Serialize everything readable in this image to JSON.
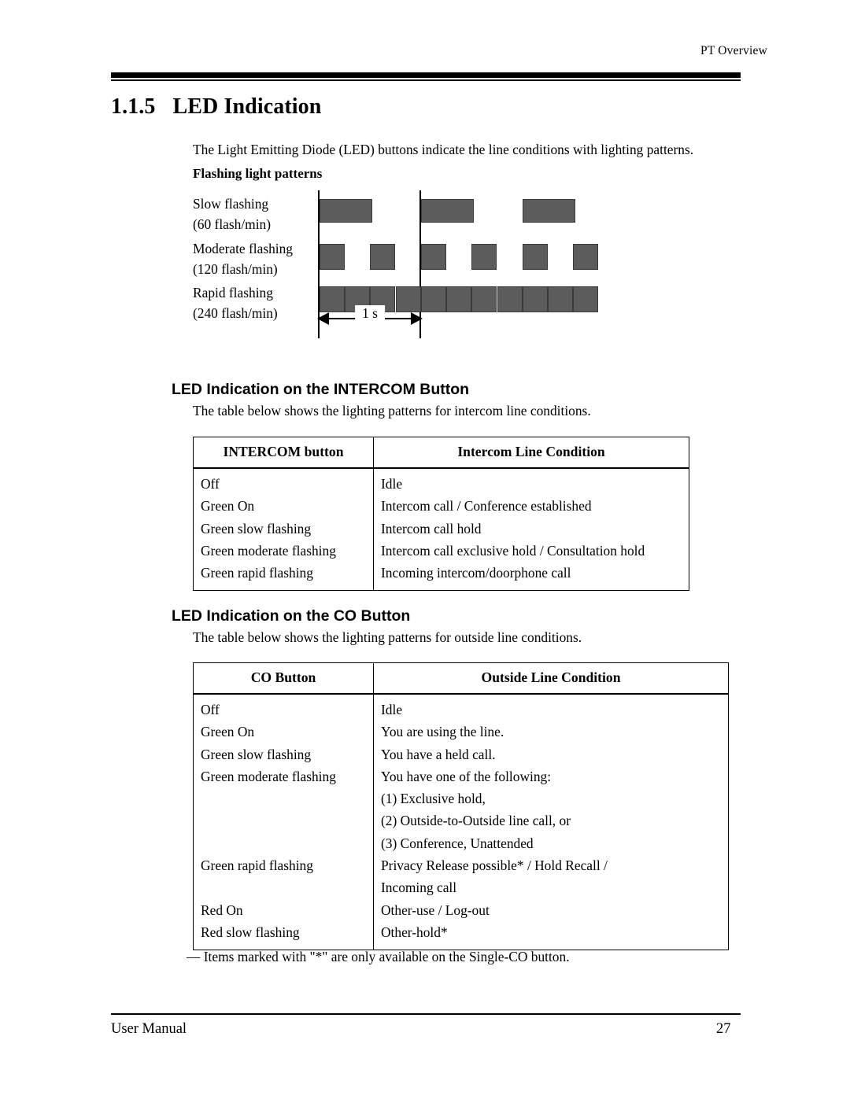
{
  "running_head": "PT Overview",
  "section": {
    "number": "1.1.5",
    "title": "LED Indication"
  },
  "intro": "The Light Emitting Diode (LED) buttons indicate the line conditions with lighting patterns.",
  "flashing_patterns_heading": "Flashing light patterns",
  "diagram": {
    "time_label": "1 s",
    "bar_color": "#5c5c5c",
    "bar_border_color": "#3b3b3b",
    "rows": [
      {
        "name": "Slow flashing",
        "rate": "(60 flash/min)"
      },
      {
        "name": "Moderate flashing",
        "rate": "(120 flash/min)"
      },
      {
        "name": "Rapid flashing",
        "rate": "(240 flash/min)"
      }
    ]
  },
  "intercom_section": {
    "heading": "LED Indication on the INTERCOM Button",
    "lead": "The table below shows the lighting patterns for intercom line conditions.",
    "columns": [
      "INTERCOM button",
      "Intercom Line Condition"
    ],
    "rows": [
      {
        "button": "Off",
        "condition": [
          "Idle"
        ]
      },
      {
        "button": "Green On",
        "condition": [
          "Intercom call / Conference established"
        ]
      },
      {
        "button": "Green slow flashing",
        "condition": [
          "Intercom call hold"
        ]
      },
      {
        "button": "Green moderate flashing",
        "condition": [
          "Intercom call exclusive hold / Consultation hold"
        ]
      },
      {
        "button": "Green rapid flashing",
        "condition": [
          "Incoming intercom/doorphone call"
        ]
      }
    ]
  },
  "co_section": {
    "heading": "LED Indication on the CO Button",
    "lead": "The table below shows the lighting patterns for outside line conditions.",
    "columns": [
      "CO Button",
      "Outside Line Condition"
    ],
    "rows": [
      {
        "button": "Off",
        "condition": [
          "Idle"
        ]
      },
      {
        "button": "Green On",
        "condition": [
          "You are using the line."
        ]
      },
      {
        "button": "Green slow flashing",
        "condition": [
          "You have a held call."
        ]
      },
      {
        "button": "Green moderate flashing",
        "condition": [
          "You have one of the following:",
          "(1) Exclusive hold,",
          "(2) Outside-to-Outside line call, or",
          "(3) Conference, Unattended"
        ]
      },
      {
        "button": "Green rapid flashing",
        "condition": [
          "Privacy Release possible* / Hold Recall /",
          "Incoming call"
        ]
      },
      {
        "button": "Red On",
        "condition": [
          "Other-use / Log-out"
        ]
      },
      {
        "button": "Red slow flashing",
        "condition": [
          "Other-hold*"
        ]
      }
    ]
  },
  "footnote": "— Items marked with \"*\" are only available on the Single-CO button.",
  "footer": {
    "left": "User Manual",
    "page": "27"
  }
}
